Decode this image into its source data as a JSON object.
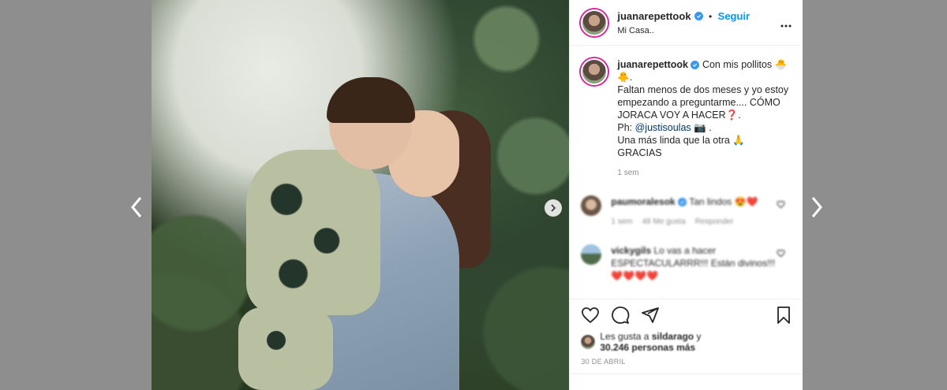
{
  "post": {
    "username": "juanarepettook",
    "follow_label": "Seguir",
    "location": "Mi Casa..",
    "separator": "•"
  },
  "caption": {
    "username": "juanarepettook",
    "line1": "Con mis pollitos 🐣🐥.",
    "line2": "Faltan menos de dos meses y yo estoy empezando a preguntarme.... CÓMO JORACA VOY A HACER❓.",
    "ph_prefix": "Ph: ",
    "ph_link": "@justisoulas",
    "ph_suffix": " 📷 .",
    "line4": "Una más linda que la otra 🙏",
    "line5": "GRACIAS",
    "time": "1 sem"
  },
  "comments": [
    {
      "username": "paumoralesok",
      "text": "Tan lindos 😍❤️",
      "time": "1 sem",
      "likes": "48 Me gusta",
      "reply": "Responder"
    },
    {
      "username": "vickygils",
      "text": "Lo vas a hacer ESPECTACULARRR!!! Están divinos!!! ❤️❤️❤️❤️"
    }
  ],
  "likes": {
    "prefix": "Les gusta a ",
    "user": "sildarago",
    "suffix": " y",
    "count": "30.246 personas más"
  },
  "date": "30 DE ABRIL",
  "icons": {
    "like": "heart-icon",
    "comment": "comment-icon",
    "share": "share-icon",
    "save": "bookmark-icon",
    "more": "more-icon",
    "prev": "chevron-left-icon",
    "next": "chevron-right-icon"
  },
  "colors": {
    "follow": "#0095f6",
    "verified": "#3897f0",
    "backdrop": "#8e8e8e"
  }
}
